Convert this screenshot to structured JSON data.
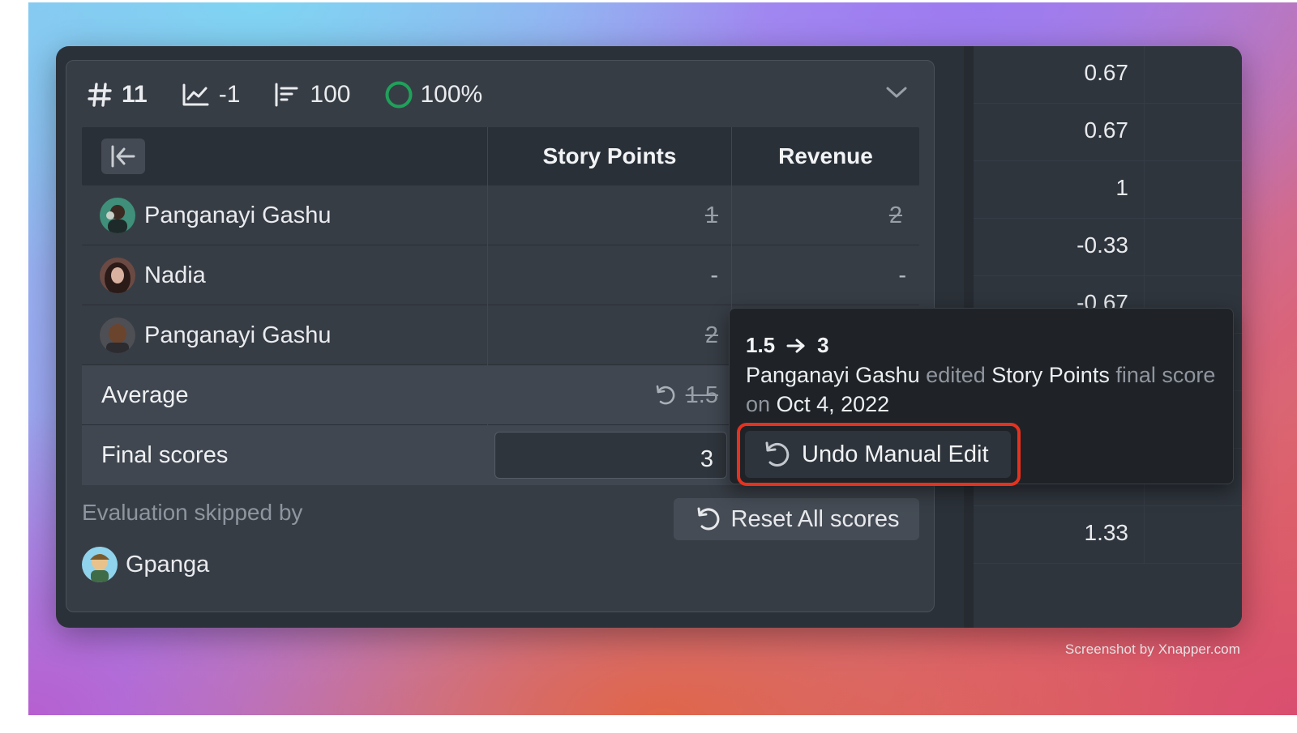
{
  "watermark": "Screenshot by Xnapper.com",
  "stats": {
    "issue_number": "11",
    "trend_value": "-1",
    "priority_value": "100",
    "progress": "100%"
  },
  "table": {
    "columns": [
      "Story Points",
      "Revenue"
    ],
    "rows": [
      {
        "name": "Panganayi Gashu",
        "story_points": "1",
        "revenue": "2",
        "struck": true
      },
      {
        "name": "Nadia",
        "story_points": "-",
        "revenue": "-",
        "struck": false
      },
      {
        "name": "Panganayi Gashu",
        "story_points": "2",
        "revenue": "",
        "struck": true
      }
    ],
    "average_label": "Average",
    "average_value": "1.5",
    "final_label": "Final scores",
    "final_value": "3"
  },
  "skipped": {
    "label": "Evaluation skipped by",
    "user": "Gpanga"
  },
  "reset_button": "Reset All scores",
  "tooltip": {
    "from": "1.5",
    "to": "3",
    "user": "Panganayi Gashu",
    "edited_text": "edited",
    "field": "Story Points",
    "final_text": "final score on",
    "date": "Oct 4, 2022",
    "undo_button": "Undo Manual Edit"
  },
  "right_column": [
    "0.67",
    "0.67",
    "1",
    "-0.33",
    "-0.67",
    "1.33"
  ],
  "colors": {
    "progress_ring": "#1fa15a",
    "highlight_border": "#e5321f"
  }
}
